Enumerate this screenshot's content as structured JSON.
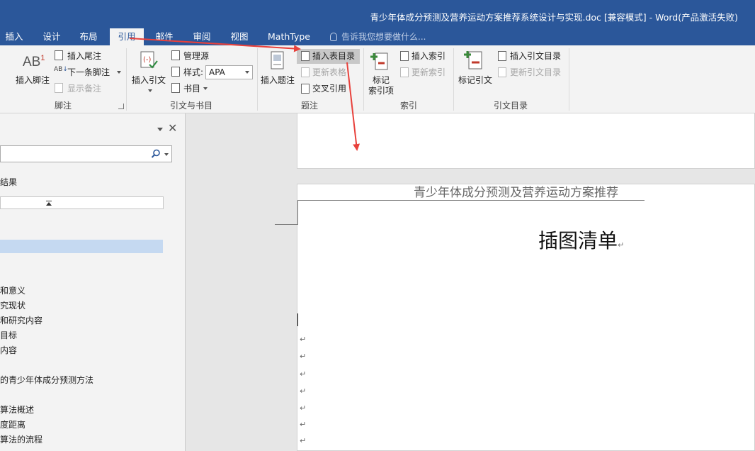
{
  "window": {
    "title": "青少年体成分预测及营养运动方案推荐系统设计与实现.doc [兼容模式] - Word(产品激活失败)"
  },
  "tabs": [
    "插入",
    "设计",
    "布局",
    "引用",
    "邮件",
    "审阅",
    "视图",
    "MathType"
  ],
  "active_tab": "引用",
  "tell_me": "告诉我您想要做什么...",
  "ribbon": {
    "footnote": {
      "insert_footnote": "插入脚注",
      "insert_endnote": "插入尾注",
      "next_footnote": "下一条脚注",
      "show_notes": "显示备注",
      "group_label": "脚注"
    },
    "citations": {
      "insert_citation": "插入引文",
      "manage_sources": "管理源",
      "style_label": "样式:",
      "style_value": "APA",
      "bibliography": "书目",
      "group_label": "引文与书目"
    },
    "captions": {
      "insert_caption": "插入题注",
      "insert_table_of_figures": "插入表目录",
      "update_table": "更新表格",
      "cross_reference": "交叉引用",
      "group_label": "题注"
    },
    "index": {
      "mark_entry_line1": "标记",
      "mark_entry_line2": "索引项",
      "insert_index": "插入索引",
      "update_index": "更新索引",
      "group_label": "索引"
    },
    "authorities": {
      "mark_citation": "标记引文",
      "insert_table_of_authorities": "插入引文目录",
      "update_table": "更新引文目录",
      "group_label": "引文目录"
    }
  },
  "nav_pane": {
    "results_label": "结果",
    "items": [
      "和意义",
      "究现状",
      "和研究内容",
      "目标",
      "内容",
      "的青少年体成分预测方法",
      "算法概述",
      "度距离",
      "算法的流程"
    ]
  },
  "document": {
    "header_text": "青少年体成分预测及营养运动方案推荐",
    "heading": "插图清单",
    "paragraph_mark": "↵"
  },
  "colors": {
    "title_bar": "#2b579a",
    "ribbon_bg": "#f3f3f3",
    "annotation_arrow": "#e8413c",
    "nav_selection": "#c5d9f1"
  }
}
